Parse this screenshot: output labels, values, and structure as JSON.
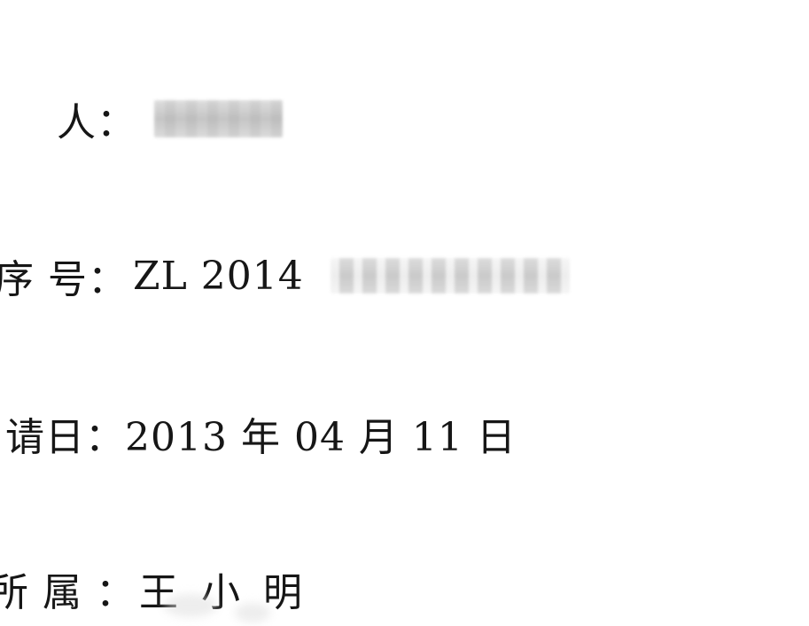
{
  "document": {
    "lines": [
      {
        "label": "人：",
        "value": ""
      },
      {
        "label": "序 号：",
        "value": "ZL 2014"
      },
      {
        "label": "请日：",
        "value": "2013 年 04 月 11 日"
      },
      {
        "label": "所 属 ：",
        "value": "王 小 明"
      }
    ]
  }
}
